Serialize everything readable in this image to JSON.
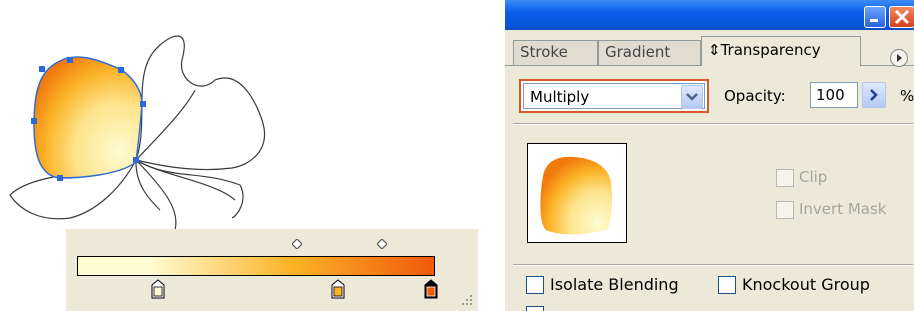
{
  "colors": {
    "gradient_start": "#fefcd2",
    "gradient_mid": "#fbb327",
    "gradient_end": "#f05a0c",
    "panel_bg": "#ece9d8",
    "selection_blue": "#2a6ad8",
    "blend_highlight": "#d45b2a"
  },
  "icons": {
    "minimize": "minimize-icon",
    "close": "close-icon",
    "panel_menu": "triangle-right-icon",
    "blend_dropdown": "chevron-down-icon",
    "opacity_popup": "chevron-right-icon"
  },
  "gradient": {
    "stops": [
      "#fefcd2",
      "#fbb327",
      "#f05a0c"
    ]
  },
  "panel": {
    "tabs": {
      "stroke": "Stroke",
      "gradient": "Gradient",
      "transparency": "⇕Transparency"
    },
    "blend_mode": "Multiply",
    "opacity_label": "Opacity:",
    "opacity_value": "100",
    "opacity_unit": "%",
    "clip_label": "Clip",
    "invert_mask_label": "Invert Mask",
    "isolate_blending_label": "Isolate Blending",
    "knockout_group_label": "Knockout Group"
  }
}
